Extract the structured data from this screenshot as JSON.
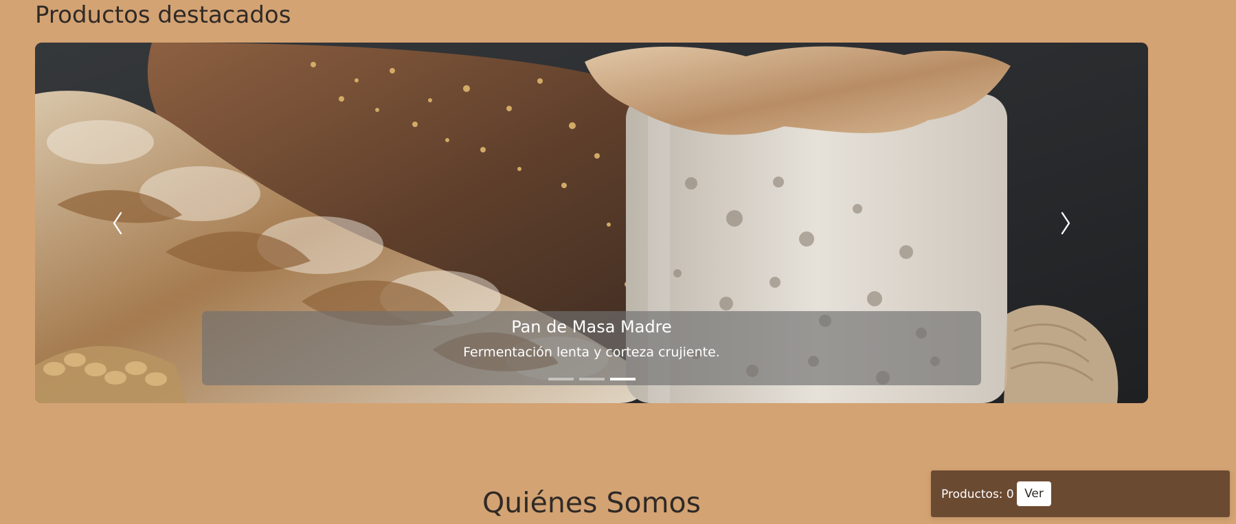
{
  "page": {
    "featured_heading": "Productos destacados",
    "about_heading": "Quiénes Somos"
  },
  "carousel": {
    "active_index": 2,
    "slides_count": 3,
    "prev_label": "Anterior",
    "next_label": "Siguiente",
    "active_slide": {
      "title": "Pan de Masa Madre",
      "text": "Fermentación lenta y corteza crujiente."
    }
  },
  "cart": {
    "label_prefix": "Productos:",
    "count": "0",
    "label": "Productos: 0",
    "button_label": "Ver"
  },
  "icons": {
    "prev": "chevron-left-icon",
    "next": "chevron-right-icon"
  },
  "colors": {
    "page_background": "#d4a373",
    "cart_background": "#6b4a32",
    "caption_overlay": "rgba(112,112,112,0.66)"
  }
}
